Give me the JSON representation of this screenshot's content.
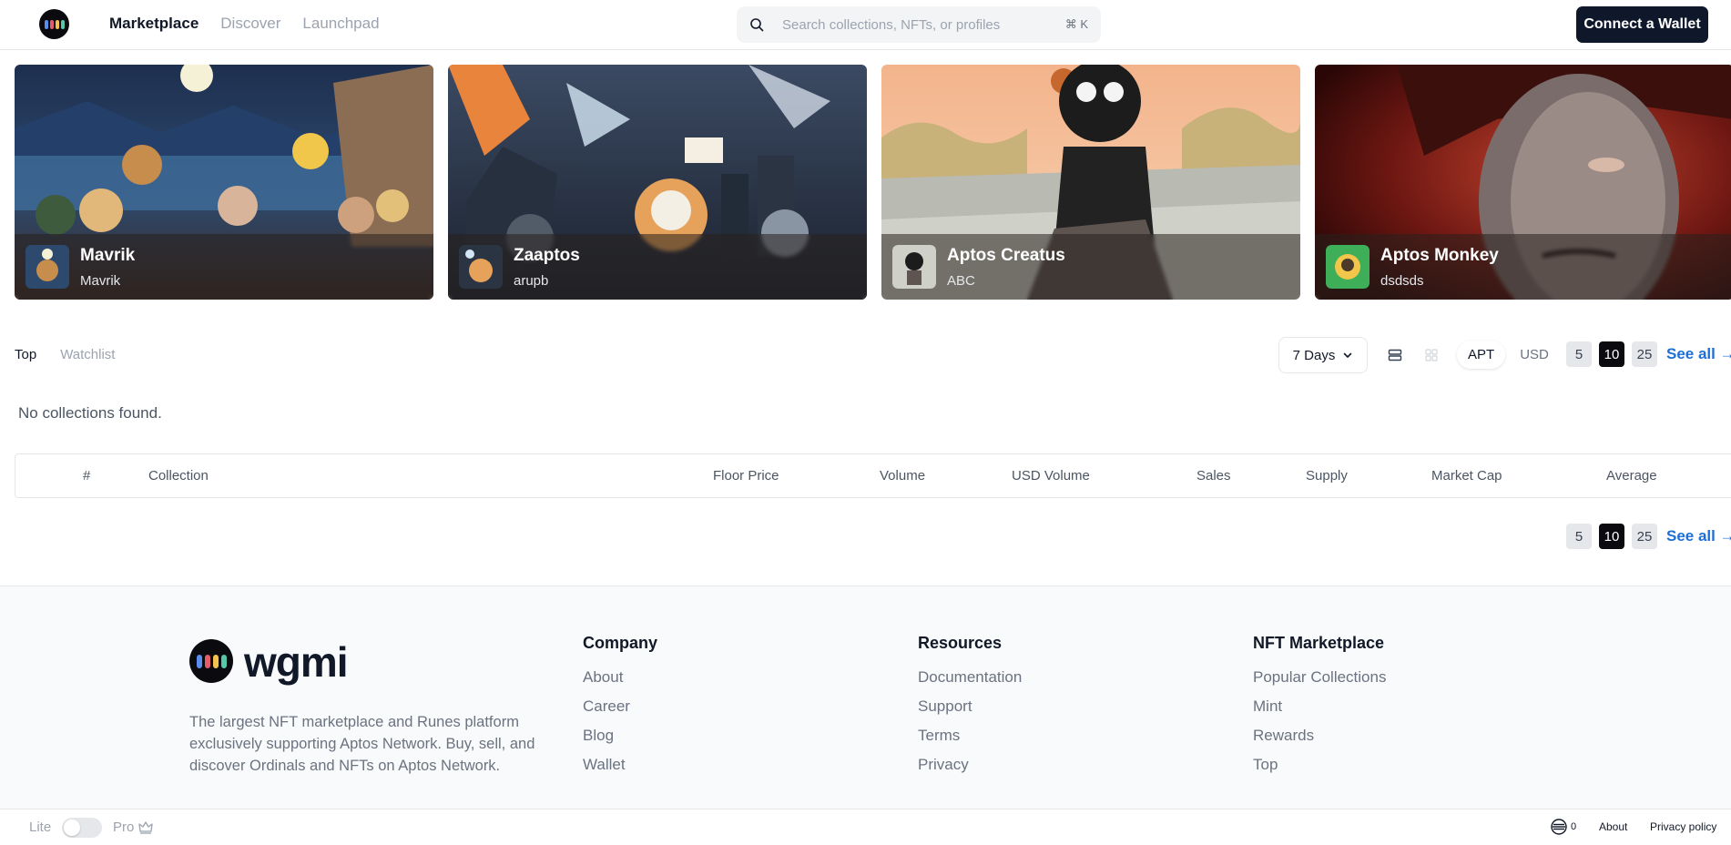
{
  "header": {
    "nav": [
      {
        "label": "Marketplace",
        "active": true
      },
      {
        "label": "Discover",
        "active": false
      },
      {
        "label": "Launchpad",
        "active": false
      }
    ],
    "search": {
      "placeholder": "Search collections, NFTs, or profiles",
      "shortcut": "⌘ K",
      "icon": "search-icon"
    },
    "connect_label": "Connect a Wallet",
    "logo_colors": [
      "#5b8def",
      "#e25c6a",
      "#f2c14e",
      "#56c7a8"
    ]
  },
  "featured": [
    {
      "name": "Mavrik",
      "creator": "Mavrik"
    },
    {
      "name": "Zaaptos",
      "creator": "arupb"
    },
    {
      "name": "Aptos Creatus",
      "creator": "ABC"
    },
    {
      "name": "Aptos Monkey",
      "creator": "dsdsds"
    }
  ],
  "toolbar": {
    "tabs": [
      {
        "label": "Top",
        "active": true
      },
      {
        "label": "Watchlist",
        "active": false
      }
    ],
    "period": "7 Days",
    "currency": [
      {
        "label": "APT",
        "active": true
      },
      {
        "label": "USD",
        "active": false
      }
    ],
    "page_sizes": [
      {
        "label": "5",
        "active": false
      },
      {
        "label": "10",
        "active": true
      },
      {
        "label": "25",
        "active": false
      }
    ],
    "see_all": "See all →"
  },
  "empty_message": "No collections found.",
  "table": {
    "columns": [
      "#",
      "Collection",
      "Floor Price",
      "Volume",
      "USD Volume",
      "Sales",
      "Supply",
      "Market Cap",
      "Average"
    ]
  },
  "footer": {
    "brand": "wgmi",
    "description": "The largest NFT marketplace and Runes platform exclusively supporting Aptos Network. Buy, sell, and discover Ordinals and NFTs on Aptos Network.",
    "columns": [
      {
        "title": "Company",
        "links": [
          "About",
          "Career",
          "Blog",
          "Wallet"
        ]
      },
      {
        "title": "Resources",
        "links": [
          "Documentation",
          "Support",
          "Terms",
          "Privacy"
        ]
      },
      {
        "title": "NFT Marketplace",
        "links": [
          "Popular Collections",
          "Mint",
          "Rewards",
          "Top"
        ]
      }
    ]
  },
  "bottom_bar": {
    "lite_label": "Lite",
    "pro_label": "Pro",
    "gas_value": "0",
    "about": "About",
    "privacy": "Privacy policy"
  },
  "colors": {
    "accent": "#1d6fd6",
    "dark": "#0f172a"
  }
}
